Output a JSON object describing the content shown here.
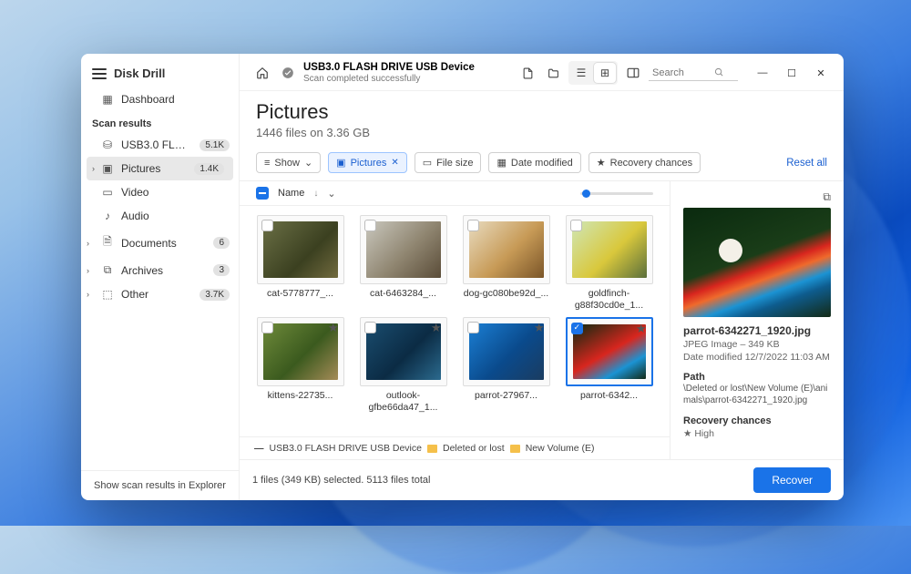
{
  "app": {
    "name": "Disk Drill"
  },
  "sidebar": {
    "dashboard": "Dashboard",
    "section_label": "Scan results",
    "items": [
      {
        "icon": "usb",
        "label": "USB3.0 FLASH DRIVE US...",
        "badge": "5.1K",
        "caret": ""
      },
      {
        "icon": "pictures",
        "label": "Pictures",
        "badge": "1.4K",
        "caret": "›",
        "active": true
      },
      {
        "icon": "video",
        "label": "Video",
        "badge": "",
        "caret": ""
      },
      {
        "icon": "audio",
        "label": "Audio",
        "badge": "",
        "caret": ""
      },
      {
        "icon": "documents",
        "label": "Documents",
        "badge": "6",
        "caret": "›"
      },
      {
        "icon": "archives",
        "label": "Archives",
        "badge": "3",
        "caret": "›"
      },
      {
        "icon": "other",
        "label": "Other",
        "badge": "3.7K",
        "caret": "›"
      }
    ],
    "footer": "Show scan results in Explorer"
  },
  "titlebar": {
    "device": "USB3.0 FLASH DRIVE USB Device",
    "status": "Scan completed successfully",
    "search_placeholder": "Search"
  },
  "page": {
    "title": "Pictures",
    "subtitle": "1446 files on 3.36 GB"
  },
  "filters": {
    "show": "Show",
    "chips": [
      "Pictures",
      "File size",
      "Date modified",
      "Recovery chances"
    ],
    "reset": "Reset all"
  },
  "columns": {
    "name": "Name"
  },
  "thumbs": [
    {
      "name": "cat-5778777_...",
      "bg": "linear-gradient(135deg,#6a6f45,#3b4020 60%,#716a3e)",
      "chk": false,
      "star": false
    },
    {
      "name": "cat-6463284_...",
      "bg": "linear-gradient(135deg,#c9c7bd,#8f8570 55%,#5a4c38)",
      "chk": false,
      "star": false
    },
    {
      "name": "dog-gc080be92d_...",
      "bg": "linear-gradient(135deg,#e8dbbf,#c79a56 55%,#7a5528)",
      "chk": false,
      "star": false
    },
    {
      "name": "goldfinch-g88f30cd0e_1...",
      "bg": "linear-gradient(135deg,#cfe6b6,#d9c83c 55%,#5b6f3c)",
      "chk": false,
      "star": false
    },
    {
      "name": "kittens-22735...",
      "bg": "linear-gradient(135deg,#6e8a3a,#3b5a1e 55%,#a58b57)",
      "chk": false,
      "star": true
    },
    {
      "name": "outlook-gfbe66da47_1...",
      "bg": "linear-gradient(135deg,#1a4d6f,#0b2b44 55%,#2b6a8e)",
      "chk": false,
      "star": true
    },
    {
      "name": "parrot-27967...",
      "bg": "linear-gradient(135deg,#1b7fd4,#0a4a8c 55%,#1a3c60)",
      "chk": false,
      "star": true
    },
    {
      "name": "parrot-6342...",
      "bg": "linear-gradient(150deg,#0a2a0f,#d8261e 50%,#1b93d3 75%,#132a15)",
      "chk": true,
      "star": true,
      "sel": true
    }
  ],
  "breadcrumb": {
    "a": "USB3.0 FLASH DRIVE USB Device",
    "b": "Deleted or lost",
    "c": "New Volume (E)"
  },
  "preview": {
    "filename": "parrot-6342271_1920.jpg",
    "meta": "JPEG Image – 349 KB",
    "modified": "Date modified 12/7/2022 11:03 AM",
    "path_label": "Path",
    "path": "\\Deleted or lost\\New Volume (E)\\animals\\parrot-6342271_1920.jpg",
    "recovery_label": "Recovery chances",
    "recovery_value": "High"
  },
  "footer": {
    "status": "1 files (349 KB) selected. 5113 files total",
    "recover": "Recover"
  }
}
